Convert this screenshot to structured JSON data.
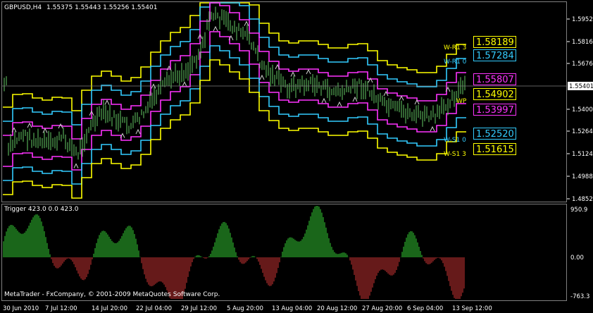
{
  "header": {
    "symbol": "GBPUSD,H4",
    "ohlc": "1.55375 1.55443 1.55256 1.55401"
  },
  "price_axis": {
    "ticks": [
      "1.59520",
      "1.58160",
      "1.56760",
      "1.55401",
      "1.54000",
      "1.52640",
      "1.51240",
      "1.49880",
      "1.48520"
    ],
    "current": "1.55401"
  },
  "levels": [
    {
      "label": "W-R1 3",
      "value": "1.58189",
      "color": "#ffff00"
    },
    {
      "label": "W-R1 0",
      "value": "1.57284",
      "color": "#33ccff"
    },
    {
      "label": "",
      "value": "1.55807",
      "color": "#ff33ff"
    },
    {
      "label": "WP",
      "value": "1.54902",
      "color": "#ffff00"
    },
    {
      "label": "",
      "value": "1.53997",
      "color": "#ff33ff"
    },
    {
      "label": "W-S1 0",
      "value": "1.52520",
      "color": "#33ccff"
    },
    {
      "label": "W-S1 3",
      "value": "1.51615",
      "color": "#ffff00"
    }
  ],
  "indicator": {
    "title": "Trigger 423.0 0.0 423.0",
    "ticks": [
      "950.9",
      "0.00",
      "-763.3"
    ]
  },
  "copyright": "MetaTrader - FxCompany, © 2001-2009 MetaQuotes Software Corp.",
  "time_axis": [
    "30 Jun 2010",
    "7 Jul 12:00",
    "14 Jul 20:00",
    "22 Jul 04:00",
    "29 Jul 12:00",
    "5 Aug 20:00",
    "13 Aug 04:00",
    "20 Aug 12:00",
    "27 Aug 20:00",
    "6 Sep 04:00",
    "13 Sep 12:00"
  ],
  "colors": {
    "up_bar": "#33cc33",
    "down_bar": "#cc3333",
    "outer_band": "#ffff00",
    "mid_band": "#33ccff",
    "inner_band": "#ff33ff",
    "candles": "#66cc66"
  }
}
